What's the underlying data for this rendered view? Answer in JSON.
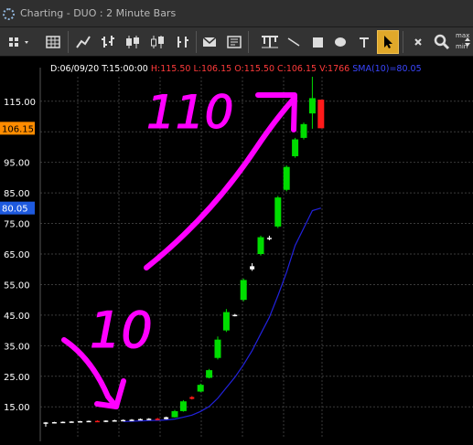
{
  "window": {
    "title": "Charting - DUO : 2 Minute Bars"
  },
  "toolbar": {
    "buttons": [
      {
        "name": "link-color-icon"
      },
      {
        "name": "grid-icon"
      },
      {
        "name": "line-chart-icon"
      },
      {
        "name": "ohlc-bar-icon"
      },
      {
        "name": "candlestick-icon"
      },
      {
        "name": "hollow-candle-icon"
      },
      {
        "name": "hlc-bar-icon"
      },
      {
        "name": "mail-icon"
      },
      {
        "name": "bar-tool-icon"
      },
      {
        "name": "draw-line-icon"
      },
      {
        "name": "draw-rectangle-icon"
      },
      {
        "name": "draw-ellipse-icon"
      },
      {
        "name": "text-tool-icon"
      },
      {
        "name": "pointer-icon"
      },
      {
        "name": "close-icon"
      },
      {
        "name": "zoom-icon"
      },
      {
        "name": "max-min-icon",
        "label_top": "max",
        "label_bottom": "min"
      }
    ]
  },
  "readout": {
    "date": "D:06/09/20 T:15:00:00",
    "ohlc": "H:115.50 L:106.15 O:115.50 C:106.15 V:1766",
    "sma": "SMA(10)=80.05"
  },
  "annotations": {
    "low_text": "10",
    "high_text": "110",
    "color": "#ff00ff"
  },
  "colors": {
    "up": "#00dd00",
    "down": "#ff1a1a",
    "sma": "#2222dd",
    "grid": "#3a3a3a",
    "axis_text": "#ffffff",
    "background": "#000000"
  },
  "chart_data": {
    "type": "candlestick",
    "title": "DUO : 2 Minute Bars",
    "ylim": [
      7,
      123
    ],
    "yticks": [
      15.0,
      25.0,
      35.0,
      45.0,
      55.0,
      65.0,
      75.0,
      85.0,
      95.0,
      105.0,
      115.0
    ],
    "tick_labels": [
      "15.00",
      "25.00",
      "35.00",
      "45.00",
      "55.00",
      "65.00",
      "75.00",
      "85.00",
      "95.00",
      "",
      "115.00"
    ],
    "grid": true,
    "price_markers": [
      {
        "value": 106.15,
        "label": "106.15",
        "color": "#ff8c00",
        "text_color": "#000000"
      },
      {
        "value": 80.05,
        "label": "80.05",
        "color": "#1e5adf",
        "text_color": "#ffffff"
      }
    ],
    "candles": [
      {
        "o": 9.8,
        "h": 10.0,
        "l": 8.5,
        "c": 9.9
      },
      {
        "o": 9.9,
        "h": 10.1,
        "l": 9.6,
        "c": 10.0
      },
      {
        "o": 10.0,
        "h": 10.2,
        "l": 9.8,
        "c": 10.1
      },
      {
        "o": 10.1,
        "h": 10.3,
        "l": 9.9,
        "c": 10.2
      },
      {
        "o": 10.2,
        "h": 10.4,
        "l": 10.0,
        "c": 10.3
      },
      {
        "o": 10.3,
        "h": 10.5,
        "l": 10.1,
        "c": 10.4
      },
      {
        "o": 10.4,
        "h": 10.6,
        "l": 10.1,
        "c": 10.2
      },
      {
        "o": 10.2,
        "h": 10.6,
        "l": 10.0,
        "c": 10.5
      },
      {
        "o": 10.5,
        "h": 10.8,
        "l": 10.3,
        "c": 10.6
      },
      {
        "o": 10.6,
        "h": 10.9,
        "l": 10.4,
        "c": 10.7
      },
      {
        "o": 10.7,
        "h": 11.0,
        "l": 10.5,
        "c": 10.8
      },
      {
        "o": 10.8,
        "h": 11.2,
        "l": 10.6,
        "c": 11.0
      },
      {
        "o": 11.0,
        "h": 11.3,
        "l": 10.8,
        "c": 11.1
      },
      {
        "o": 11.1,
        "h": 11.4,
        "l": 10.9,
        "c": 11.0
      },
      {
        "o": 11.0,
        "h": 11.8,
        "l": 10.9,
        "c": 11.6
      },
      {
        "o": 11.6,
        "h": 14.0,
        "l": 11.5,
        "c": 13.6
      },
      {
        "o": 13.6,
        "h": 17.2,
        "l": 13.4,
        "c": 16.8
      },
      {
        "o": 18.2,
        "h": 18.5,
        "l": 17.4,
        "c": 17.6
      },
      {
        "o": 20.0,
        "h": 22.6,
        "l": 19.8,
        "c": 22.2
      },
      {
        "o": 24.5,
        "h": 27.4,
        "l": 24.3,
        "c": 27.0
      },
      {
        "o": 31.0,
        "h": 38.0,
        "l": 30.5,
        "c": 37.0
      },
      {
        "o": 40.0,
        "h": 47.0,
        "l": 39.5,
        "c": 46.0
      },
      {
        "o": 45.0,
        "h": 45.4,
        "l": 44.6,
        "c": 45.1
      },
      {
        "o": 50.0,
        "h": 57.0,
        "l": 49.5,
        "c": 56.5
      },
      {
        "o": 60.0,
        "h": 62.0,
        "l": 59.5,
        "c": 61.0
      },
      {
        "o": 65.0,
        "h": 71.0,
        "l": 64.5,
        "c": 70.5
      },
      {
        "o": 70.0,
        "h": 71.0,
        "l": 69.5,
        "c": 70.3
      },
      {
        "o": 74.0,
        "h": 84.0,
        "l": 73.5,
        "c": 83.5
      },
      {
        "o": 86.0,
        "h": 94.0,
        "l": 85.5,
        "c": 93.5
      },
      {
        "o": 97.0,
        "h": 103.0,
        "l": 96.5,
        "c": 102.5
      },
      {
        "o": 103.0,
        "h": 108.0,
        "l": 102.5,
        "c": 107.5
      },
      {
        "o": 111.0,
        "h": 123.0,
        "l": 106.0,
        "c": 116.0
      },
      {
        "o": 115.5,
        "h": 115.5,
        "l": 106.15,
        "c": 106.15
      }
    ],
    "sma": [
      null,
      null,
      null,
      null,
      null,
      null,
      null,
      null,
      null,
      10.2,
      10.3,
      10.4,
      10.5,
      10.6,
      10.7,
      11.0,
      11.6,
      12.3,
      13.5,
      15.1,
      17.8,
      21.3,
      24.7,
      28.8,
      33.4,
      38.9,
      44.3,
      51.4,
      59.0,
      67.8,
      73.5,
      79.2,
      80.05
    ]
  }
}
